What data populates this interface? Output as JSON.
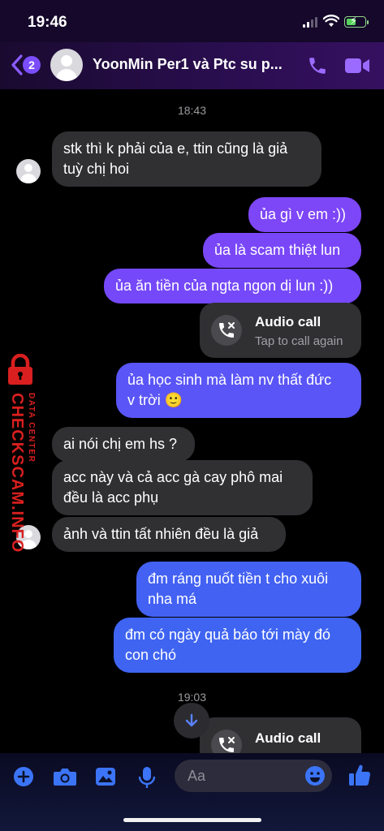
{
  "status_bar": {
    "time": "19:46"
  },
  "header": {
    "unread_badge": "2",
    "title": "YoonMin Per1 và Ptc su p...",
    "accent_color": "#7b4dff"
  },
  "messages": [
    {
      "kind": "time",
      "text": "18:43"
    },
    {
      "kind": "in",
      "text": "stk thì k phải của e, ttin cũng là giả\ntuỳ chị hoi"
    },
    {
      "kind": "out",
      "text": "ủa gì v em :))"
    },
    {
      "kind": "out",
      "text": "ủa là scam thiệt lun"
    },
    {
      "kind": "out",
      "text": "ủa ăn tiền của ngta ngon dị lun :))"
    },
    {
      "kind": "call",
      "title": "Audio call",
      "subtitle": "Tap to call again"
    },
    {
      "kind": "out",
      "text": "ủa học sinh mà làm nv thất đức\nv trời 🙂"
    },
    {
      "kind": "in",
      "text": "ai nói chị em hs ?"
    },
    {
      "kind": "in",
      "text": "acc này và cả acc gà cay phô mai\nđều là acc phụ"
    },
    {
      "kind": "in",
      "text": "ảnh và ttin tất nhiên đều là giả"
    },
    {
      "kind": "out",
      "text": "đm ráng nuốt tiền t cho xuôi\nnha má"
    },
    {
      "kind": "out",
      "text": "đm có ngày quả báo tới mày đó\ncon chó"
    },
    {
      "kind": "time",
      "text": "19:03"
    },
    {
      "kind": "call",
      "title": "Audio call",
      "subtitle": ""
    }
  ],
  "watermark": {
    "brand": "CHECKSCAM.INFO",
    "sub": "DATA CENTER"
  },
  "composer": {
    "placeholder": "Aa"
  },
  "icons": {
    "header": [
      "back-chevron-icon",
      "phone-icon",
      "video-camera-icon"
    ],
    "composer": [
      "plus-icon",
      "camera-icon",
      "gallery-icon",
      "microphone-icon",
      "emoji-icon",
      "thumbs-up-icon"
    ],
    "other": [
      "missed-call-icon",
      "arrow-down-icon",
      "padlock-icon"
    ]
  }
}
